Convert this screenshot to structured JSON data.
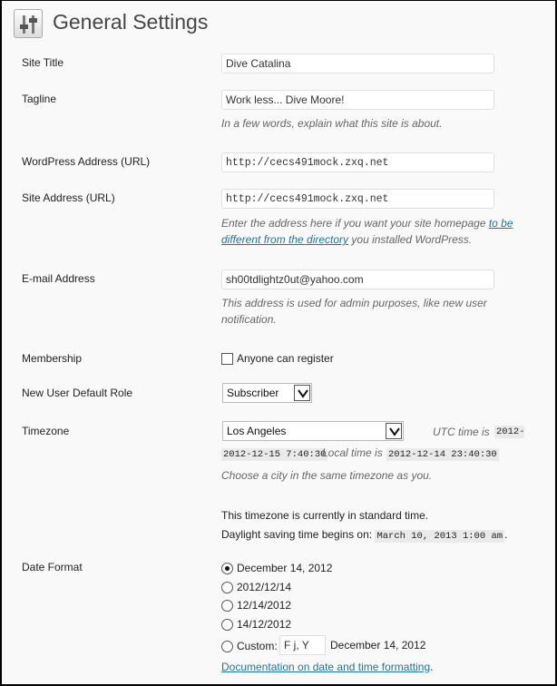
{
  "page": {
    "title": "General Settings",
    "icon": "settings-sliders-icon"
  },
  "site_title": {
    "label": "Site Title",
    "value": "Dive Catalina"
  },
  "tagline": {
    "label": "Tagline",
    "value": "Work less... Dive Moore!",
    "description": "In a few words, explain what this site is about."
  },
  "wp_address": {
    "label": "WordPress Address (URL)",
    "value": "http://cecs491mock.zxq.net"
  },
  "site_address": {
    "label": "Site Address (URL)",
    "value": "http://cecs491mock.zxq.net",
    "desc_before": "Enter the address here if you want your site homepage ",
    "desc_link": "to be different from the directory",
    "desc_after": " you installed WordPress."
  },
  "email": {
    "label": "E-mail Address",
    "value": "sh00tdlightz0ut@yahoo.com",
    "description": "This address is used for admin purposes, like new user notification."
  },
  "membership": {
    "label": "Membership",
    "option": "Anyone can register",
    "checked": false
  },
  "default_role": {
    "label": "New User Default Role",
    "selected": "Subscriber"
  },
  "timezone": {
    "label": "Timezone",
    "selected": "Los Angeles",
    "utc_label": "UTC time is",
    "utc_time": "2012-12-15 7:40:30",
    "local_label": "Local time is",
    "local_time": "2012-12-14 23:40:30",
    "description": "Choose a city in the same timezone as you.",
    "standard_note": "This timezone is currently in standard time.",
    "dst_label": "Daylight saving time begins on:",
    "dst_date": "March 10, 2013 1:00 am",
    "dst_period": "."
  },
  "date_format": {
    "label": "Date Format",
    "options": [
      {
        "label": "December 14, 2012",
        "checked": true
      },
      {
        "label": "2012/12/14",
        "checked": false
      },
      {
        "label": "12/14/2012",
        "checked": false
      },
      {
        "label": "14/12/2012",
        "checked": false
      }
    ],
    "custom_label": "Custom:",
    "custom_value": "F j, Y",
    "custom_preview": "December 14, 2012",
    "doc_link": "Documentation on date and time formatting",
    "doc_period": "."
  },
  "colors": {
    "link": "#21759b",
    "description": "#666666"
  }
}
